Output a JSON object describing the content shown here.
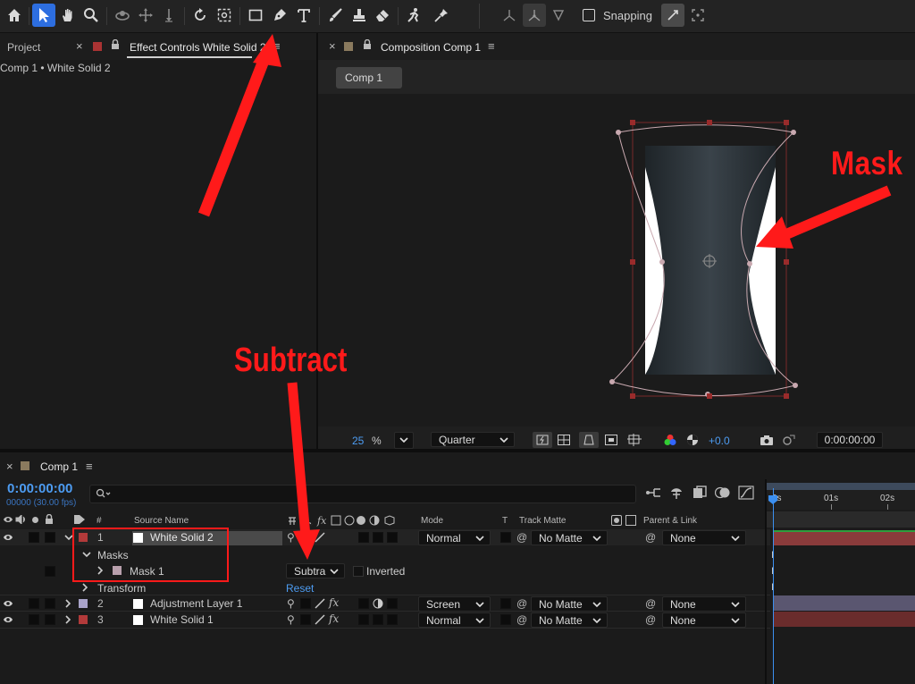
{
  "toolbar": {
    "snapping_label": "Snapping",
    "icons": [
      "home-icon",
      "selection-tool-icon",
      "hand-tool-icon",
      "zoom-tool-icon",
      "orbit-tool-icon",
      "pan-tool-icon",
      "dolly-tool-icon",
      "rotate-tool-icon",
      "anchor-tool-icon",
      "rectangle-tool-icon",
      "pen-tool-icon",
      "type-tool-icon",
      "brush-tool-icon",
      "clone-stamp-icon",
      "eraser-icon",
      "roto-brush-icon",
      "puppet-pin-icon"
    ]
  },
  "left_panel": {
    "tab_project": "Project",
    "tab_effect_controls": "Effect Controls White Solid 2",
    "breadcrumb": "Comp 1 • White Solid 2"
  },
  "comp_panel": {
    "tab_label": "Composition Comp 1",
    "comp_button": "Comp 1",
    "zoom_value": "25",
    "zoom_unit": "%",
    "resolution": "Quarter",
    "exposure": "+0.0",
    "timecode": "0:00:00:00"
  },
  "annotations": {
    "mask_label": "Mask",
    "subtract_label": "Subtract",
    "accent_color": "#ff1a1a"
  },
  "timeline": {
    "tab_label": "Comp 1",
    "current_time": "0:00:00:00",
    "frame_info": "00000 (30.00 fps)",
    "search_placeholder": "",
    "header": {
      "num": "#",
      "source_name": "Source Name",
      "mode": "Mode",
      "t": "T",
      "track_matte": "Track Matte",
      "parent_link": "Parent & Link"
    },
    "ruler": [
      "0s",
      "01s",
      "02s"
    ],
    "layers": [
      {
        "num": "1",
        "name": "White Solid 2",
        "label_color": "#b23a3a",
        "mode": "Normal",
        "matte": "No Matte",
        "parent": "None"
      },
      {
        "num": "2",
        "name": "Adjustment Layer 1",
        "label_color": "#a9a3c9",
        "mode": "Screen",
        "matte": "No Matte",
        "parent": "None"
      },
      {
        "num": "3",
        "name": "White Solid 1",
        "label_color": "#b23a3a",
        "mode": "Normal",
        "matte": "No Matte",
        "parent": "None"
      }
    ],
    "masks_label": "Masks",
    "mask_name": "Mask 1",
    "mask_mode": "Subtra",
    "inverted_label": "Inverted",
    "transform_label": "Transform",
    "reset_label": "Reset"
  }
}
